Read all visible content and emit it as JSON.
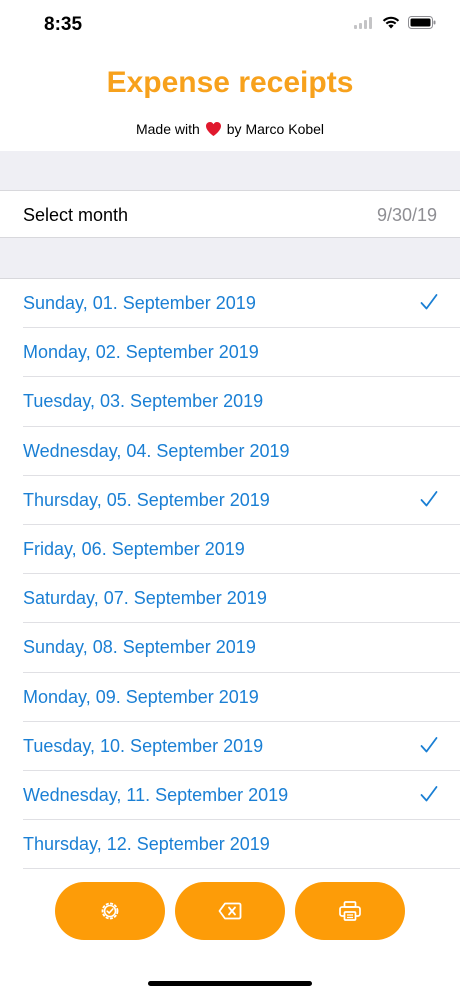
{
  "status_bar": {
    "time": "8:35"
  },
  "header": {
    "title": "Expense receipts",
    "subtitle_prefix": "Made with",
    "subtitle_suffix": "by Marco Kobel"
  },
  "select_month": {
    "label": "Select month",
    "value": "9/30/19"
  },
  "days": [
    {
      "label": "Sunday, 01. September 2019",
      "checked": true
    },
    {
      "label": "Monday, 02. September 2019",
      "checked": false
    },
    {
      "label": "Tuesday, 03. September 2019",
      "checked": false
    },
    {
      "label": "Wednesday, 04. September 2019",
      "checked": false
    },
    {
      "label": "Thursday, 05. September 2019",
      "checked": true
    },
    {
      "label": "Friday, 06. September 2019",
      "checked": false
    },
    {
      "label": "Saturday, 07. September 2019",
      "checked": false
    },
    {
      "label": "Sunday, 08. September 2019",
      "checked": false
    },
    {
      "label": "Monday, 09. September 2019",
      "checked": false
    },
    {
      "label": "Tuesday, 10. September 2019",
      "checked": true
    },
    {
      "label": "Wednesday, 11. September 2019",
      "checked": true
    },
    {
      "label": "Thursday, 12. September 2019",
      "checked": false
    }
  ],
  "actions": [
    {
      "icon": "settings-icon"
    },
    {
      "icon": "delete-icon"
    },
    {
      "icon": "print-icon"
    }
  ],
  "colors": {
    "accent": "#f7a11c",
    "button": "#fd9c08",
    "link": "#1a7fd4",
    "heart": "#e0182d"
  }
}
